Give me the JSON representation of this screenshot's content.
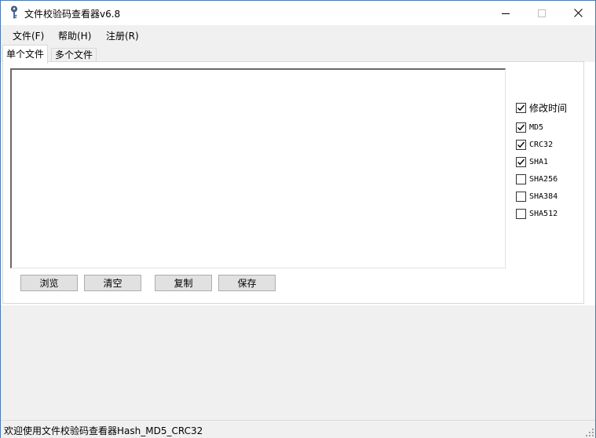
{
  "window": {
    "title": "文件校验码查看器v6.8"
  },
  "menu": {
    "items": [
      "文件(F)",
      "帮助(H)",
      "注册(R)"
    ]
  },
  "tabs": [
    "单个文件",
    "多个文件"
  ],
  "buttons": {
    "browse": "浏览",
    "clear": "清空",
    "copy": "复制",
    "save": "保存"
  },
  "options": [
    {
      "label": "修改时间",
      "checked": true
    },
    {
      "label": "MD5",
      "checked": true
    },
    {
      "label": "CRC32",
      "checked": true
    },
    {
      "label": "SHA1",
      "checked": true
    },
    {
      "label": "SHA256",
      "checked": false
    },
    {
      "label": "SHA384",
      "checked": false
    },
    {
      "label": "SHA512",
      "checked": false
    }
  ],
  "textarea": {
    "value": ""
  },
  "status": {
    "text": "欢迎使用文件校验码查看器Hash_MD5_CRC32"
  }
}
